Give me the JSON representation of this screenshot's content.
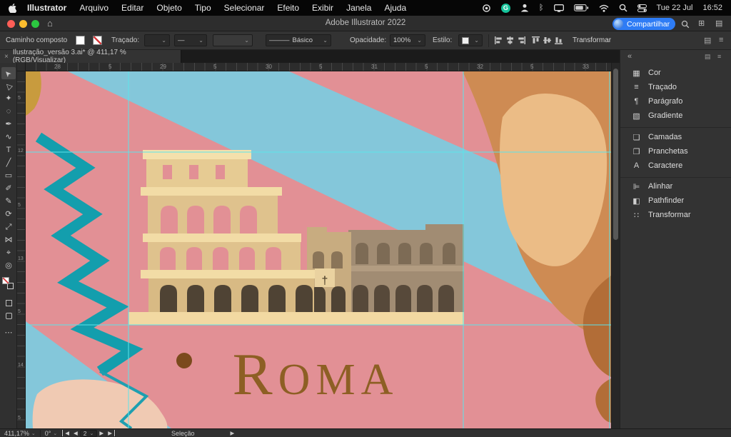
{
  "menubar": {
    "items": [
      "Illustrator",
      "Arquivo",
      "Editar",
      "Objeto",
      "Tipo",
      "Selecionar",
      "Efeito",
      "Exibir",
      "Janela",
      "Ajuda"
    ],
    "date": "Tue 22 Jul",
    "time": "16:52",
    "grammarly_glyph": "G"
  },
  "titlebar": {
    "title": "Adobe Illustrator 2022",
    "share_label": "Compartilhar",
    "home_glyph": "⌂",
    "icon_grid": "⊞",
    "icon_list": "▤"
  },
  "controlbar": {
    "selection_label": "Caminho composto",
    "stroke_label": "Traçado:",
    "profile_value": "—",
    "brush_line": "———",
    "brush_value": "Básico",
    "opacity_label": "Opacidade:",
    "opacity_value": "100%",
    "style_label": "Estilo:",
    "transform_label": "Transformar",
    "icon_grid": "▤",
    "icon_menu": "≡"
  },
  "tab": {
    "close_glyph": "×",
    "title": "Ilustração_versão 3.ai* @ 411,17 % (RGB/Visualizar)"
  },
  "toolbar": {
    "tools": [
      {
        "name": "selection-tool",
        "glyph": "➤"
      },
      {
        "name": "direct-selection-tool",
        "glyph": "▷"
      },
      {
        "name": "magic-wand-tool",
        "glyph": "✦"
      },
      {
        "name": "lasso-tool",
        "glyph": "◌"
      },
      {
        "name": "pen-tool",
        "glyph": "✒"
      },
      {
        "name": "curvature-tool",
        "glyph": "∿"
      },
      {
        "name": "type-tool",
        "glyph": "T"
      },
      {
        "name": "line-segment-tool",
        "glyph": "╱"
      },
      {
        "name": "rectangle-tool",
        "glyph": "▭"
      },
      {
        "name": "paintbrush-tool",
        "glyph": "✐"
      },
      {
        "name": "pencil-tool",
        "glyph": "✎"
      },
      {
        "name": "rotate-tool",
        "glyph": "⟳"
      },
      {
        "name": "scale-tool",
        "glyph": "⤢"
      },
      {
        "name": "width-tool",
        "glyph": "⋈"
      },
      {
        "name": "eyedropper-tool",
        "glyph": "⌖"
      },
      {
        "name": "zoom-tool",
        "glyph": "◎"
      }
    ],
    "more_glyph": "⋯"
  },
  "rulers": {
    "top": [
      "28",
      "5",
      "29",
      "5",
      "30",
      "5",
      "31",
      "5",
      "32",
      "5",
      "33"
    ],
    "left": [
      "5",
      "12",
      "5",
      "13",
      "5",
      "14",
      "5"
    ]
  },
  "canvas": {
    "title_initial": "R",
    "title_rest": "OMA",
    "cross": "†"
  },
  "panel": {
    "collapse_glyph": "«",
    "icon_grid": "▤",
    "icon_menu": "≡",
    "groups": [
      {
        "items": [
          {
            "glyph": "▦",
            "label": "Cor"
          },
          {
            "glyph": "≡",
            "label": "Traçado"
          },
          {
            "glyph": "¶",
            "label": "Parágrafo"
          },
          {
            "glyph": "▧",
            "label": "Gradiente"
          }
        ]
      },
      {
        "items": [
          {
            "glyph": "❏",
            "label": "Camadas"
          },
          {
            "glyph": "❐",
            "label": "Pranchetas"
          },
          {
            "glyph": "A",
            "label": "Caractere"
          }
        ]
      },
      {
        "items": [
          {
            "glyph": "⊫",
            "label": "Alinhar"
          },
          {
            "glyph": "◧",
            "label": "Pathfinder"
          },
          {
            "glyph": "∷",
            "label": "Transformar"
          }
        ]
      }
    ]
  },
  "statusbar": {
    "zoom": "411,17%",
    "rotation": "0°",
    "artboard": "2",
    "status": "Seleção"
  },
  "ui": {
    "chevron": "⌄",
    "arrow_left": "◀",
    "arrow_right": "▶"
  },
  "palette": {
    "pink": "#E29095",
    "blue": "#84C7DA",
    "teal": "#139EAD",
    "orange": "#CE8B53",
    "orange_light": "#EBBC86",
    "orange_dark": "#B26D37",
    "mustard": "#C89B3E",
    "cream": "#F2DCA6",
    "sand": "#DFC28D",
    "sand_dark": "#D8BA84",
    "stone": "#A18C73",
    "arch_dark": "#4F4334",
    "text_brown": "#8D5F24",
    "guide": "#5BE4EA",
    "accent_blue": "#2E7CF5"
  }
}
